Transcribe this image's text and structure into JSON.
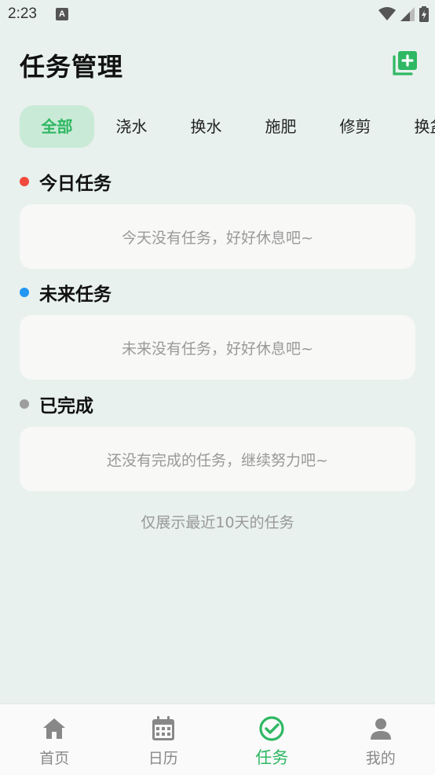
{
  "status_bar": {
    "time": "2:23",
    "app_icon_letter": "A"
  },
  "header": {
    "title": "任务管理",
    "add_icon": "add-box-icon"
  },
  "filter_tabs": [
    {
      "label": "全部",
      "active": true
    },
    {
      "label": "浇水",
      "active": false
    },
    {
      "label": "换水",
      "active": false
    },
    {
      "label": "施肥",
      "active": false
    },
    {
      "label": "修剪",
      "active": false
    },
    {
      "label": "换盆",
      "active": false
    }
  ],
  "sections": {
    "today": {
      "title": "今日任务",
      "dot_color": "#f04a3f",
      "empty_text": "今天没有任务，好好休息吧~"
    },
    "future": {
      "title": "未来任务",
      "dot_color": "#2196f3",
      "empty_text": "未来没有任务，好好休息吧~"
    },
    "done": {
      "title": "已完成",
      "dot_color": "#9e9e9e",
      "empty_text": "还没有完成的任务，继续努力吧~"
    }
  },
  "footer_note": "仅展示最近10天的任务",
  "bottom_nav": [
    {
      "label": "首页",
      "icon": "home-icon",
      "active": false
    },
    {
      "label": "日历",
      "icon": "calendar-icon",
      "active": false
    },
    {
      "label": "任务",
      "icon": "check-circle-icon",
      "active": true
    },
    {
      "label": "我的",
      "icon": "person-icon",
      "active": false
    }
  ],
  "colors": {
    "accent": "#2fb863",
    "background": "#e8f1ed",
    "card": "#f8f8f7"
  }
}
